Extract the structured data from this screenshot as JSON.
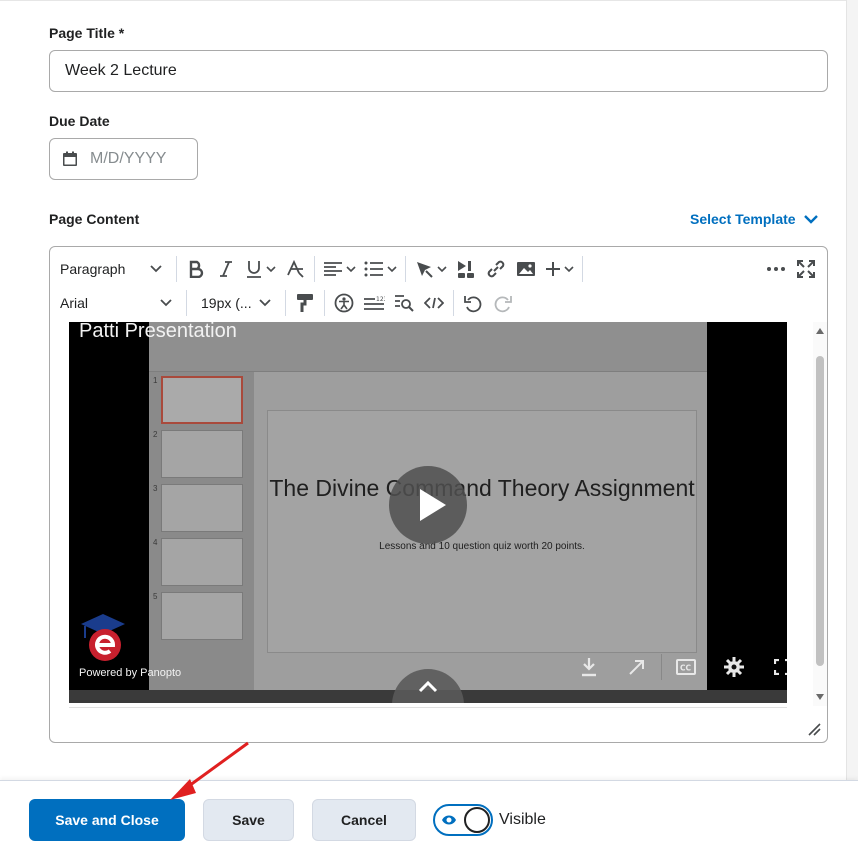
{
  "form": {
    "page_title_label": "Page Title *",
    "page_title_value": "Week 2 Lecture",
    "due_date_label": "Due Date",
    "due_date_placeholder": "M/D/YYYY",
    "page_content_label": "Page Content",
    "select_template": "Select Template"
  },
  "toolbar": {
    "format_block": "Paragraph",
    "font_family": "Arial",
    "font_size": "19px (..."
  },
  "video": {
    "title": "Patti Presentation",
    "slide_title": "The Divine Command Theory Assignment",
    "slide_subtitle": "Lessons and 10 question quiz worth 20 points.",
    "powered_by": "Powered by Panopto",
    "thumb_numbers": [
      "1",
      "2",
      "3",
      "4",
      "5"
    ]
  },
  "footer": {
    "save_and_close": "Save and Close",
    "save": "Save",
    "cancel": "Cancel",
    "visible_label": "Visible"
  },
  "colors": {
    "primary": "#006fbf",
    "secondary_button": "#e3e9f1",
    "annotation_arrow": "#e02020"
  },
  "icons": [
    "calendar-icon",
    "chevron-down-icon",
    "bold-icon",
    "italic-icon",
    "underline-icon",
    "strikethrough-format-icon",
    "align-left-icon",
    "list-icon",
    "highlighter-icon",
    "media-icon",
    "link-icon",
    "image-icon",
    "plus-icon",
    "more-icon",
    "fullscreen-icon",
    "paint-format-icon",
    "accessibility-icon",
    "word-count-icon",
    "find-replace-icon",
    "source-code-icon",
    "undo-icon",
    "redo-icon",
    "play-icon",
    "download-icon",
    "share-icon",
    "captions-icon",
    "settings-icon",
    "video-fullscreen-icon",
    "eye-icon"
  ]
}
